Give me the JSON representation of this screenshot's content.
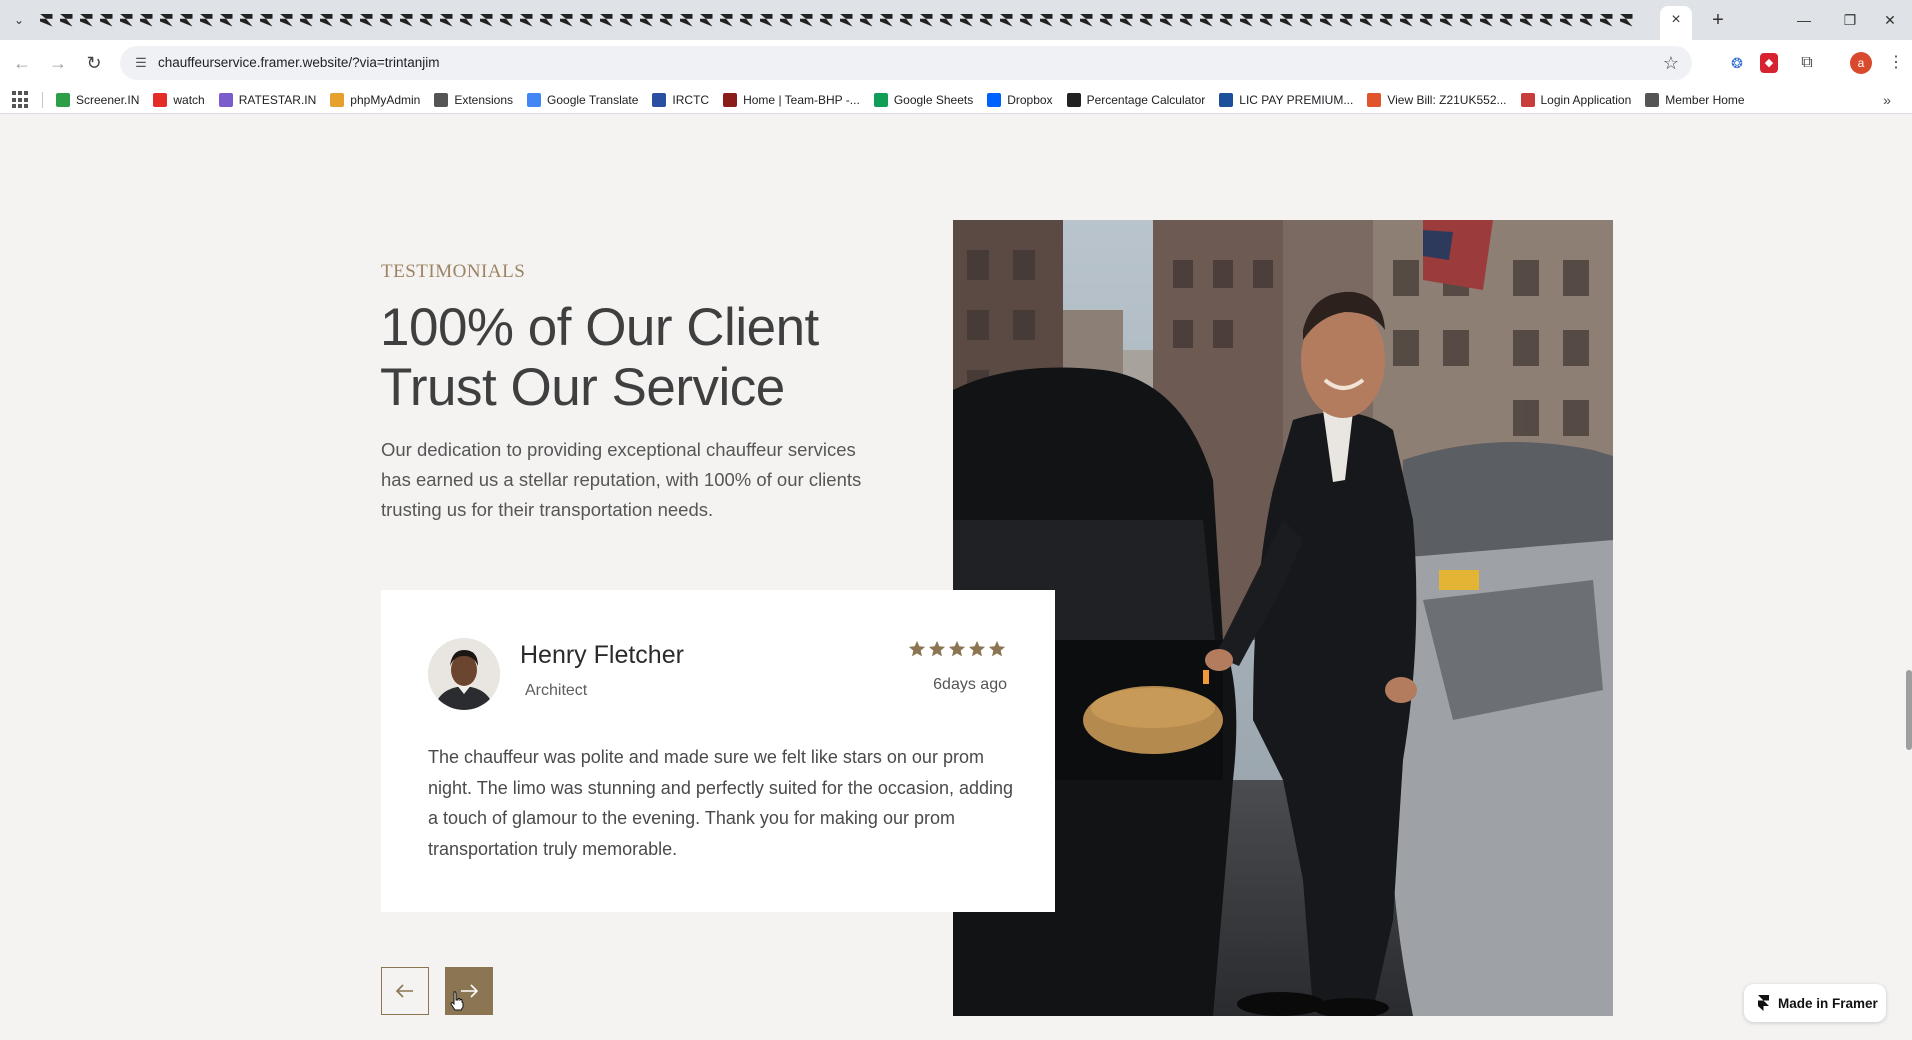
{
  "browser": {
    "url": "chauffeurservice.framer.website/?via=trintanjim",
    "profile_initial": "a",
    "bookmarks": [
      {
        "label": "Screener.IN",
        "color": "#2e9e47"
      },
      {
        "label": "watch",
        "color": "#e52d27"
      },
      {
        "label": "RATESTAR.IN",
        "color": "#7a5ccc"
      },
      {
        "label": "phpMyAdmin",
        "color": "#e5a02d"
      },
      {
        "label": "Extensions",
        "color": "#555555"
      },
      {
        "label": "Google Translate",
        "color": "#4285f4"
      },
      {
        "label": "IRCTC",
        "color": "#2a4fa0"
      },
      {
        "label": "Home | Team-BHP -...",
        "color": "#8a1c1c"
      },
      {
        "label": "Google Sheets",
        "color": "#0f9d58"
      },
      {
        "label": "Dropbox",
        "color": "#0061ff"
      },
      {
        "label": "Percentage Calculator",
        "color": "#222222"
      },
      {
        "label": "LIC PAY PREMIUM...",
        "color": "#1c4f9c"
      },
      {
        "label": "View Bill: Z21UK552...",
        "color": "#e0552d"
      },
      {
        "label": "Login Application",
        "color": "#c83c3c"
      },
      {
        "label": "Member Home",
        "color": "#555555"
      }
    ]
  },
  "section": {
    "eyebrow": "TESTIMONIALS",
    "headline": "100% of Our Client Trust Our Service",
    "intro": "Our dedication to providing exceptional chauffeur services has earned us a stellar reputation, with 100% of our clients trusting us for their transportation needs."
  },
  "testimonial": {
    "name": "Henry Fletcher",
    "role": "Architect",
    "rating": 5,
    "age": "6days ago",
    "text": "The chauffeur was polite and made sure we felt like stars on our prom night. The limo was stunning and perfectly suited for the occasion, adding a touch of glamour to the evening. Thank you for making our prom transportation truly memorable."
  },
  "badge": {
    "label": "Made in Framer"
  },
  "colors": {
    "accent": "#8b7553",
    "eyebrow": "#9c8463",
    "background": "#f4f3f2"
  }
}
